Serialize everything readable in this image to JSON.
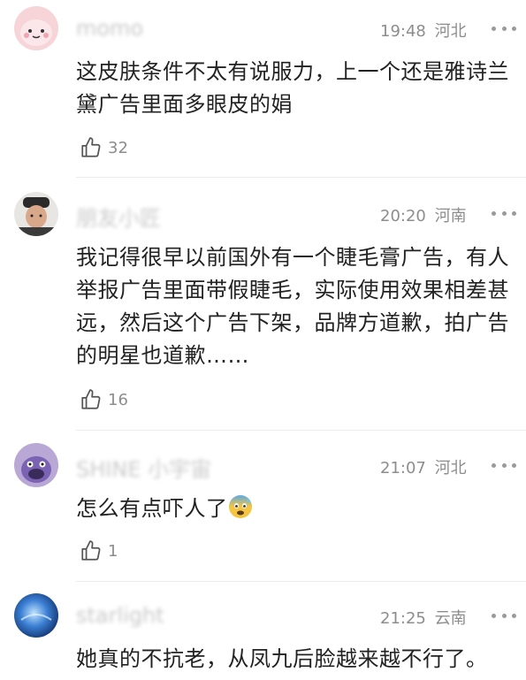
{
  "comments": [
    {
      "username": "momo",
      "time": "19:48",
      "region": "河北",
      "text": "这皮肤条件不太有说服力，上一个还是雅诗兰黛广告里面多眼皮的娟",
      "likes": "32",
      "avatar_icon": "pink-cartoon-face"
    },
    {
      "username": "朋友小匠",
      "time": "20:20",
      "region": "河南",
      "text": "我记得很早以前国外有一个睫毛膏广告，有人举报广告里面带假睫毛，实际使用效果相差甚远，然后这个广告下架，品牌方道歉，拍广告的明星也道歉……",
      "likes": "16",
      "avatar_icon": "man-in-cap-photo"
    },
    {
      "username": "SHINE 小宇宙",
      "time": "21:07",
      "region": "河北",
      "text": "怎么有点吓人了",
      "likes": "1",
      "avatar_icon": "purple-monster-cartoon",
      "emoji": "anxious-face-with-sweat"
    },
    {
      "username": "starlight",
      "time": "21:25",
      "region": "云南",
      "text": "她真的不抗老，从凤九后脸越来越不行了。",
      "likes": "",
      "avatar_icon": "blue-ocean-picture"
    }
  ],
  "colors": {
    "meta": "#8d8d8d",
    "text": "#222222",
    "divider": "#ececec"
  }
}
